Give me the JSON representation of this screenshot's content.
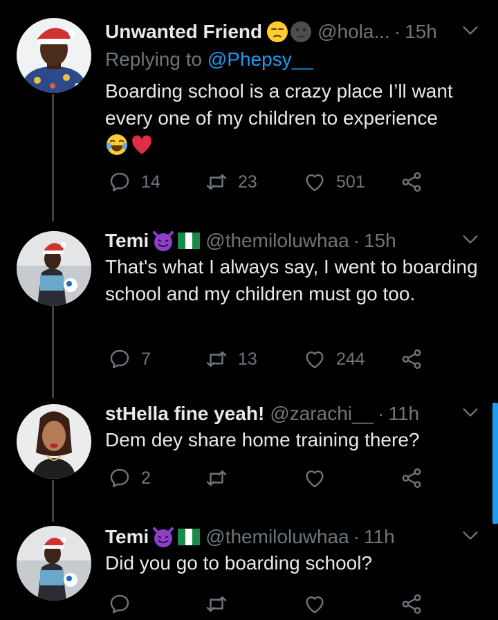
{
  "tweets": [
    {
      "name": "Unwanted Friend",
      "handle": "@hola...",
      "time": "15h",
      "replying_label": "Replying to",
      "replying_to": "@Phepsy__",
      "text": "Boarding school is a crazy place I’ll want every one of my children to experience",
      "replies": "14",
      "retweets": "23",
      "likes": "501"
    },
    {
      "name": "Temi",
      "handle": "@themiloluwhaa",
      "time": "15h",
      "text": "That's what I always say, I went to boarding school and my children must go too.",
      "replies": "7",
      "retweets": "13",
      "likes": "244"
    },
    {
      "name": "stHella fine yeah!",
      "handle": "@zarachi__",
      "time": "11h",
      "text": "Dem dey share home training there?",
      "replies": "2",
      "retweets": "",
      "likes": ""
    },
    {
      "name": "Temi",
      "handle": "@themiloluwhaa",
      "time": "11h",
      "text": "Did you go to boarding school?",
      "replies": "",
      "retweets": "",
      "likes": ""
    }
  ],
  "icons": [
    "reply-icon",
    "retweet-icon",
    "like-icon",
    "share-icon",
    "chevron-down-icon"
  ],
  "colors": {
    "background": "#000000",
    "text": "#e7e9ea",
    "muted": "#6e767d",
    "link": "#1d9bf0"
  }
}
